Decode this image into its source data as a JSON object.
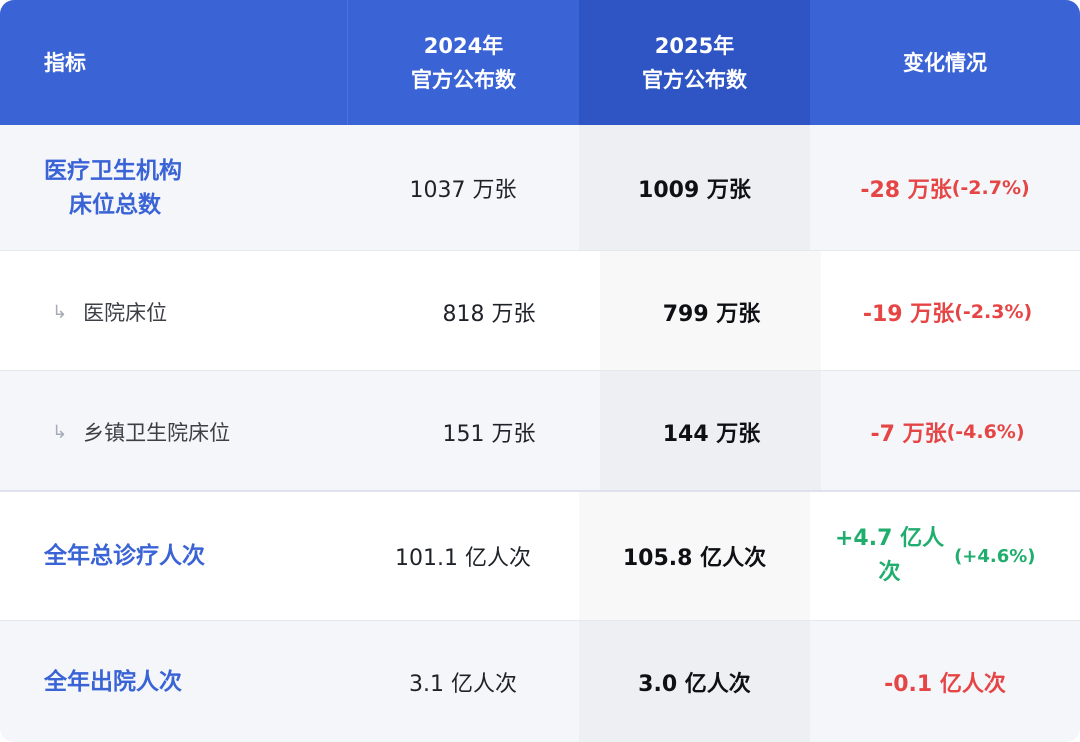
{
  "header": {
    "indicator": "指标",
    "y2024_line1": "2024年",
    "y2024_line2": "官方公布数",
    "y2025_line1": "2025年",
    "y2025_line2": "官方公布数",
    "change": "变化情况"
  },
  "rows": [
    {
      "label_line1": "医疗卫生机构",
      "label_line2": "床位总数",
      "v2024": "1037 万张",
      "v2025": "1009 万张",
      "change": "-28 万张",
      "change_pct": "(-2.7%)"
    },
    {
      "arrow": "↳",
      "label": "医院床位",
      "v2024": "818 万张",
      "v2025": "799 万张",
      "change": "-19 万张",
      "change_pct": "(-2.3%)"
    },
    {
      "arrow": "↳",
      "label": "乡镇卫生院床位",
      "v2024": "151 万张",
      "v2025": "144 万张",
      "change": "-7 万张",
      "change_pct": "(-4.6%)"
    },
    {
      "label": "全年总诊疗人次",
      "v2024": "101.1 亿人次",
      "v2025": "105.8 亿人次",
      "change_line1": "+4.7 亿人",
      "change_line2": "次",
      "change_pct": "(+4.6%)"
    },
    {
      "label": "全年出院人次",
      "v2024": "3.1 亿人次",
      "v2025": "3.0 亿人次",
      "change": "-0.1 亿人次"
    }
  ],
  "colors": {
    "header_bg": "#3a63d6",
    "header_highlight_bg": "#2f54c4",
    "label_blue": "#3a63d6",
    "negative": "#e64545",
    "positive": "#1fae6e"
  },
  "icons": {
    "sub_row_arrow": "return-arrow-icon"
  }
}
